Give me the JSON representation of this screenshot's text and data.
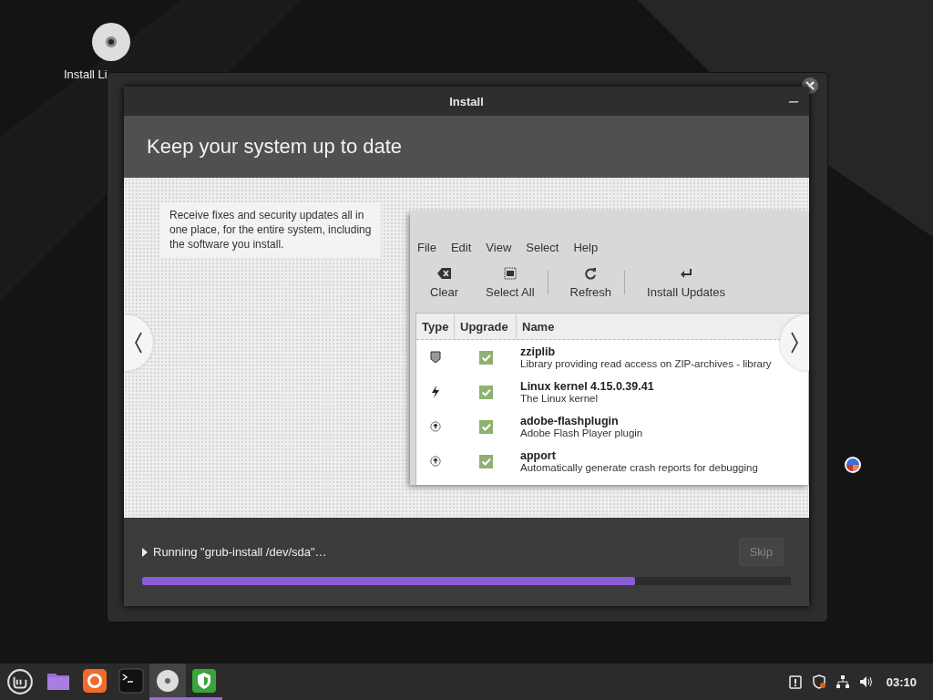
{
  "desktop": {
    "icons": [
      {
        "kind": "disc",
        "label": "Install Li"
      }
    ]
  },
  "dialog": {
    "title": "Install",
    "heading": "Keep your system up to date",
    "description": "Receive fixes and security updates all in one place, for the entire system, including the software you install.",
    "preview": {
      "menu": [
        "File",
        "Edit",
        "View",
        "Select",
        "Help"
      ],
      "toolbar": [
        {
          "kind": "clear",
          "label": "Clear",
          "separator": false
        },
        {
          "kind": "select-all",
          "label": "Select All",
          "separator": false
        },
        {
          "kind": "refresh",
          "label": "Refresh",
          "separator": true
        },
        {
          "kind": "install",
          "label": "Install Updates",
          "separator": true
        }
      ],
      "columns": [
        "Type",
        "Upgrade",
        "Name"
      ],
      "rows": [
        {
          "kind": "security",
          "checked": true,
          "name": "zziplib",
          "description": "Library providing read access on ZIP-archives - library"
        },
        {
          "kind": "kernel",
          "checked": true,
          "name": "Linux kernel 4.15.0.39.41",
          "description": "The Linux kernel"
        },
        {
          "kind": "package",
          "checked": true,
          "name": "adobe-flashplugin",
          "description": "Adobe Flash Player plugin"
        },
        {
          "kind": "package",
          "checked": true,
          "name": "apport",
          "description": "Automatically generate crash reports for debugging"
        }
      ]
    },
    "status": "Running \"grub-install /dev/sda\"…",
    "skip_button": {
      "label": "Skip",
      "disabled": true
    },
    "progress": {
      "level": 0.76
    }
  },
  "taskbar": {
    "apps": [
      {
        "kind": "folder",
        "selected": false,
        "running": false
      },
      {
        "kind": "browser",
        "selected": false,
        "running": false
      },
      {
        "kind": "terminal",
        "selected": false,
        "running": false
      },
      {
        "kind": "disc",
        "selected": true,
        "running": true
      },
      {
        "kind": "shield",
        "selected": false,
        "running": true
      }
    ],
    "clock": "03:10"
  }
}
